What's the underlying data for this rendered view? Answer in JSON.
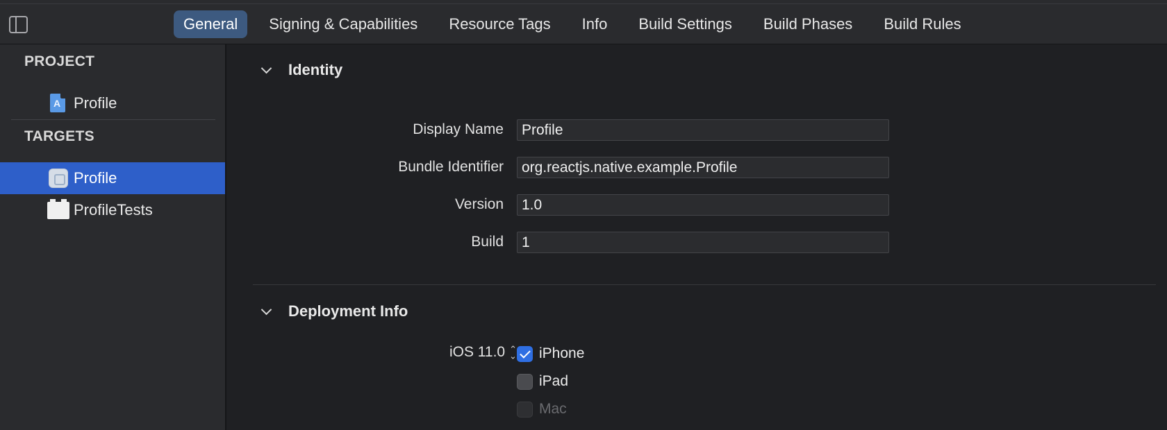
{
  "tabs": [
    {
      "label": "General",
      "active": true
    },
    {
      "label": "Signing & Capabilities"
    },
    {
      "label": "Resource Tags"
    },
    {
      "label": "Info"
    },
    {
      "label": "Build Settings"
    },
    {
      "label": "Build Phases"
    },
    {
      "label": "Build Rules"
    }
  ],
  "sidebar": {
    "project_header": "PROJECT",
    "project_item": "Profile",
    "targets_header": "TARGETS",
    "targets": [
      {
        "label": "Profile",
        "selected": true,
        "icon": "app-icon"
      },
      {
        "label": "ProfileTests",
        "selected": false,
        "icon": "test-bundle-icon"
      }
    ]
  },
  "identity": {
    "title": "Identity",
    "fields": [
      {
        "label": "Display Name",
        "value": "Profile"
      },
      {
        "label": "Bundle Identifier",
        "value": "org.reactjs.native.example.Profile"
      },
      {
        "label": "Version",
        "value": "1.0"
      },
      {
        "label": "Build",
        "value": "1"
      }
    ]
  },
  "deployment": {
    "title": "Deployment Info",
    "ios_version": "iOS 11.0",
    "devices": [
      {
        "label": "iPhone",
        "checked": true,
        "enabled": true
      },
      {
        "label": "iPad",
        "checked": false,
        "enabled": true
      },
      {
        "label": "Mac",
        "checked": false,
        "enabled": false
      }
    ]
  },
  "colors": {
    "accent": "#2f6fe3",
    "selection": "#2e5fc9",
    "active_tab": "#3d5a80"
  }
}
